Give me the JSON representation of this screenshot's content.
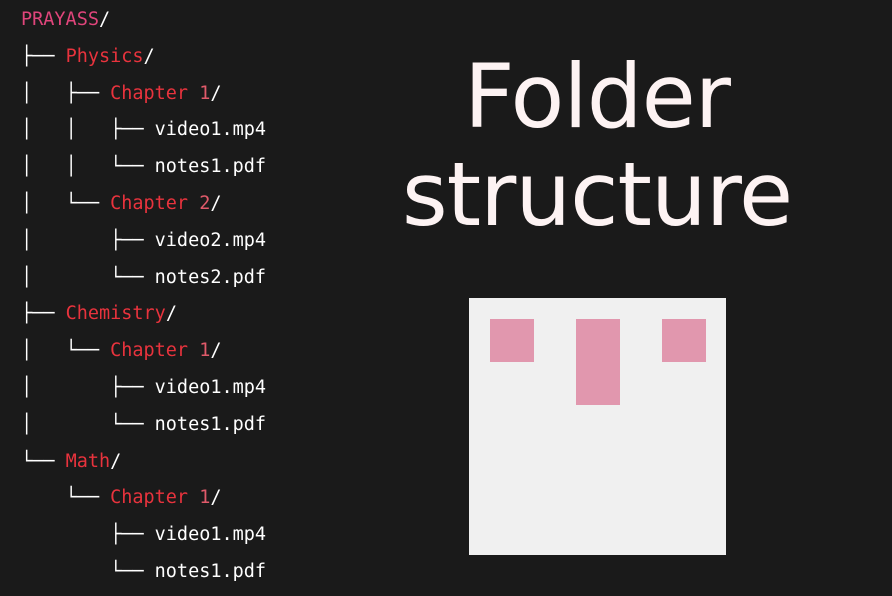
{
  "tree": [
    {
      "prefix": "",
      "name": "PRAYASS",
      "num": "",
      "suffix": "/",
      "kind": "root"
    },
    {
      "prefix": "├── ",
      "name": "Physics",
      "num": "",
      "suffix": "/",
      "kind": "dir"
    },
    {
      "prefix": "│   ├── ",
      "name": "Chapter ",
      "num": "1",
      "suffix": "/",
      "kind": "dir"
    },
    {
      "prefix": "│   │   ├── ",
      "name": "video1.mp4",
      "num": "",
      "suffix": "",
      "kind": "file"
    },
    {
      "prefix": "│   │   └── ",
      "name": "notes1.pdf",
      "num": "",
      "suffix": "",
      "kind": "file"
    },
    {
      "prefix": "│   └── ",
      "name": "Chapter ",
      "num": "2",
      "suffix": "/",
      "kind": "dir"
    },
    {
      "prefix": "│       ├── ",
      "name": "video2.mp4",
      "num": "",
      "suffix": "",
      "kind": "file"
    },
    {
      "prefix": "│       └── ",
      "name": "notes2.pdf",
      "num": "",
      "suffix": "",
      "kind": "file"
    },
    {
      "prefix": "├── ",
      "name": "Chemistry",
      "num": "",
      "suffix": "/",
      "kind": "dir"
    },
    {
      "prefix": "│   └── ",
      "name": "Chapter ",
      "num": "1",
      "suffix": "/",
      "kind": "dir"
    },
    {
      "prefix": "│       ├── ",
      "name": "video1.mp4",
      "num": "",
      "suffix": "",
      "kind": "file"
    },
    {
      "prefix": "│       └── ",
      "name": "notes1.pdf",
      "num": "",
      "suffix": "",
      "kind": "file"
    },
    {
      "prefix": "└── ",
      "name": "Math",
      "num": "",
      "suffix": "/",
      "kind": "dir"
    },
    {
      "prefix": "    └── ",
      "name": "Chapter ",
      "num": "1",
      "suffix": "/",
      "kind": "dir"
    },
    {
      "prefix": "        ├── ",
      "name": "video1.mp4",
      "num": "",
      "suffix": "",
      "kind": "file"
    },
    {
      "prefix": "        └── ",
      "name": "notes1.pdf",
      "num": "",
      "suffix": "",
      "kind": "file"
    }
  ],
  "title": {
    "line1": "Folder",
    "line2": "structure"
  },
  "colors": {
    "background": "#1a1a1a",
    "root_dir": "#e0457b",
    "dir": "#e8333d",
    "text": "#ffffff",
    "logo_bg": "#f0f0f0",
    "logo_block": "#e197ae"
  }
}
